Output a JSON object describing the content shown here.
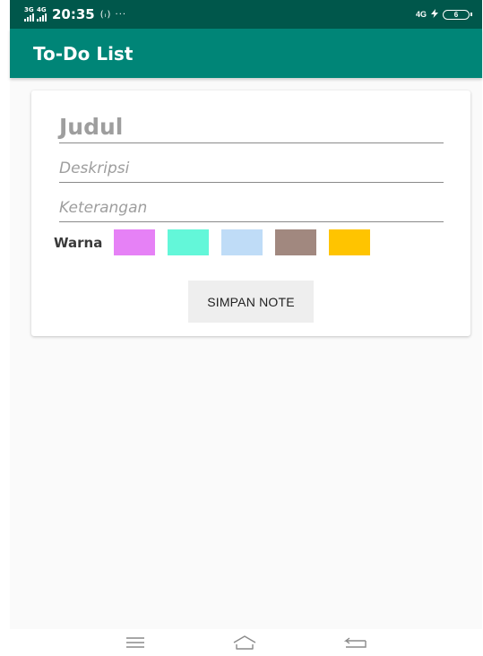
{
  "status_bar": {
    "signal_1_tag": "3G",
    "signal_2_tag": "4G",
    "time": "20:35",
    "extras": "(ᵢ) ···",
    "network": "4G",
    "battery_level": "6"
  },
  "app_bar": {
    "title": "To-Do List"
  },
  "form": {
    "title_placeholder": "Judul",
    "description_placeholder": "Deskripsi",
    "note_placeholder": "Keterangan",
    "color_label": "Warna",
    "colors": [
      "#e681f6",
      "#63f7d9",
      "#bfdcf7",
      "#a1887f",
      "#ffc400"
    ],
    "save_label": "SIMPAN NOTE"
  },
  "colors": {
    "status_bar": "#00574b",
    "app_bar": "#008577"
  }
}
